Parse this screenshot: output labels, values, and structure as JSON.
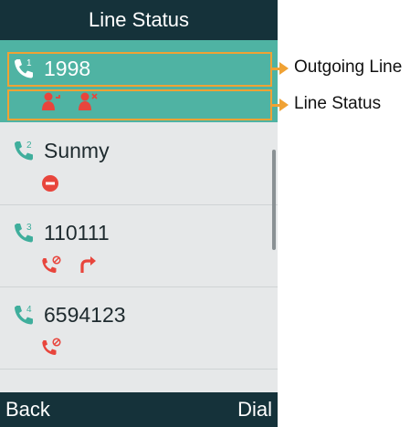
{
  "header": {
    "title": "Line Status"
  },
  "lines": [
    {
      "index": "1",
      "number": "1998",
      "statuses": [
        "presence-away-icon",
        "presence-offline-icon"
      ]
    },
    {
      "index": "2",
      "number": "Sunmy",
      "statuses": [
        "do-not-disturb-icon"
      ]
    },
    {
      "index": "3",
      "number": "110111",
      "statuses": [
        "call-rejected-icon",
        "call-forward-icon"
      ]
    },
    {
      "index": "4",
      "number": "6594123",
      "statuses": [
        "call-rejected-icon"
      ]
    }
  ],
  "softkeys": {
    "left": "Back",
    "right": "Dial"
  },
  "callouts": {
    "outgoing": "Outgoing Line",
    "status": "Line Status"
  },
  "colors": {
    "header_bg": "#15323a",
    "selected_bg": "#4fb3a3",
    "status_red": "#e8453c",
    "phone_icon": "#3fae9c",
    "callout_orange": "#f0a234"
  }
}
